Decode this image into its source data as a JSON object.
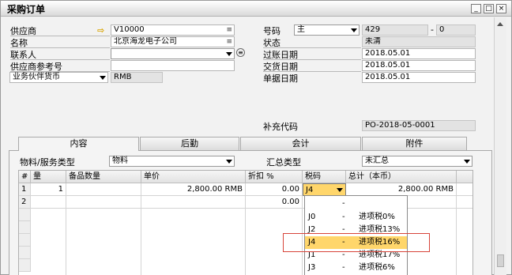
{
  "window": {
    "title": "采购订单",
    "controls": {
      "minimize": "_",
      "maximize": "□",
      "close": "×"
    }
  },
  "header_left": {
    "vendor_label": "供应商",
    "vendor_code": "V10000",
    "name_label": "名称",
    "name_value": "北京海龙电子公司",
    "contact_label": "联系人",
    "contact_value": "",
    "vendor_ref_label": "供应商参考号",
    "vendor_ref_value": "",
    "currency_label": "业务伙伴货币",
    "currency_value": "RMB"
  },
  "header_right": {
    "number_label": "号码",
    "series_value": "主",
    "doc_number": "429",
    "dash": "-",
    "doc_sub": "0",
    "status_label": "状态",
    "status_value": "未清",
    "posting_date_label": "过账日期",
    "posting_date_value": "2018.05.01",
    "delivery_date_label": "交货日期",
    "delivery_date_value": "2018.05.01",
    "doc_date_label": "单据日期",
    "doc_date_value": "2018.05.01",
    "replenish_label": "补充代码",
    "replenish_value": "PO-2018-05-0001"
  },
  "tabs": [
    {
      "label": "内容",
      "active": true
    },
    {
      "label": "后勤",
      "active": false
    },
    {
      "label": "会计",
      "active": false
    },
    {
      "label": "附件",
      "active": false
    }
  ],
  "content": {
    "item_type_label": "物料/服务类型",
    "item_type_value": "物料",
    "summary_type_label": "汇总类型",
    "summary_type_value": "未汇总"
  },
  "grid": {
    "columns": [
      "#",
      "量",
      "备品数量",
      "单价",
      "折扣 %",
      "税码",
      "总计（本币）"
    ],
    "rows": [
      {
        "no": "1",
        "qty": "1",
        "spare": "",
        "price": "2,800.00 RMB",
        "discount": "0.00",
        "tax": "J4",
        "total": "2,800.00 RMB"
      },
      {
        "no": "2",
        "qty": "",
        "spare": "",
        "price": "",
        "discount": "0.00",
        "tax": "",
        "total": ""
      }
    ]
  },
  "tax_popup": {
    "rows": [
      {
        "code": "",
        "dash": "-",
        "name": ""
      },
      {
        "code": "J0",
        "dash": "-",
        "name": "进项税0%"
      },
      {
        "code": "J2",
        "dash": "-",
        "name": "进项税13%"
      },
      {
        "code": "J4",
        "dash": "-",
        "name": "进项税16%",
        "selected": true
      },
      {
        "code": "J1",
        "dash": "-",
        "name": "进项税17%"
      },
      {
        "code": "J3",
        "dash": "-",
        "name": "进项税6%"
      }
    ]
  },
  "colors": {
    "selected_row": "#ffd66b",
    "highlight_box": "#d7443a",
    "link_arrow": "#d9a400"
  }
}
